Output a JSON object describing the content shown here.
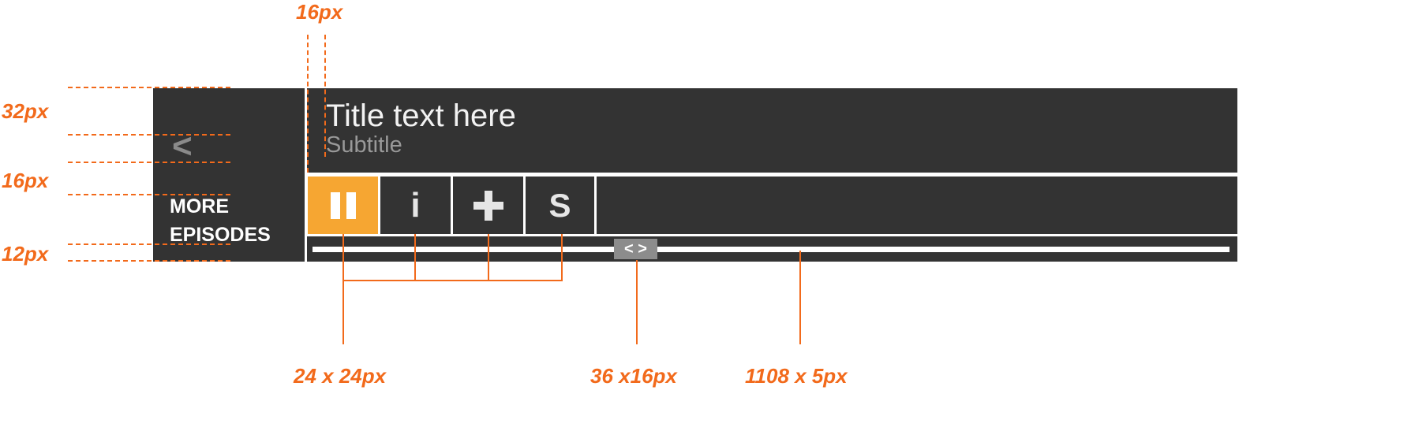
{
  "player": {
    "back_icon": "chevron-left-icon",
    "back_glyph": "<",
    "more_episodes_line1": "MORE",
    "more_episodes_line2": "EPISODES",
    "title": "Title text here",
    "subtitle": "Subtitle",
    "controls": [
      {
        "icon": "pause-icon",
        "glyph": "II",
        "active": true
      },
      {
        "icon": "info-icon",
        "glyph": "i",
        "active": false
      },
      {
        "icon": "plus-icon",
        "glyph": "+",
        "active": false
      },
      {
        "icon": "s-icon",
        "glyph": "S",
        "active": false
      }
    ],
    "scrubber_glyph": "< >",
    "colors": {
      "panel": "#333333",
      "accent": "#f6a632",
      "annotation": "#f26a1b",
      "subtitle": "#999999",
      "scrubber_handle": "#8c8c8c"
    }
  },
  "annotations": {
    "top_padding": "16px",
    "left_row1": "32px",
    "left_row2": "16px",
    "left_row3": "12px",
    "button_size": "24 x 24px",
    "scrubber_size": "36 x16px",
    "bar_size": "1108 x 5px"
  }
}
